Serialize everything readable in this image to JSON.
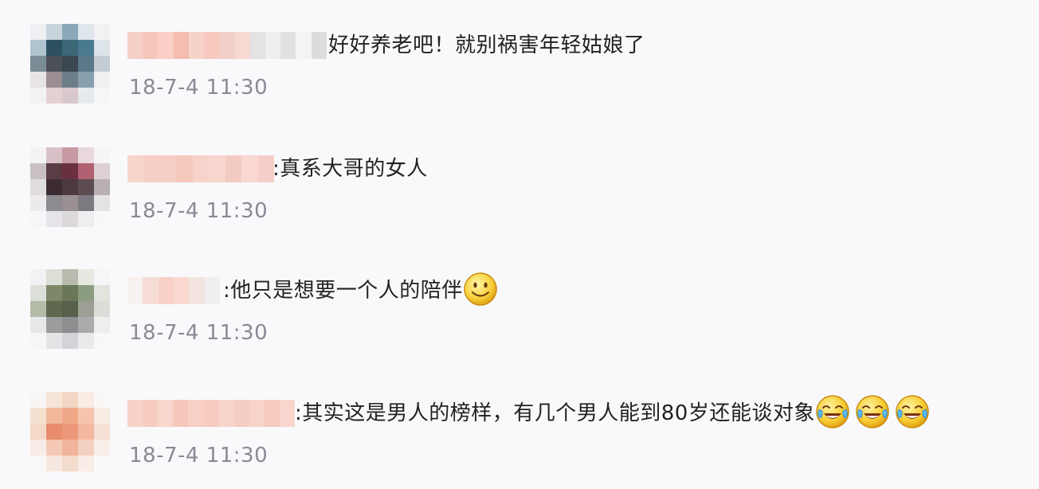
{
  "comments": [
    {
      "text": "好好养老吧！就别祸害年轻姑娘了",
      "time": "18-7-4 11:30",
      "emojis": [],
      "avatar_colors": [
        "#f0f0f4",
        "#c8d4dc",
        "#8ca8b8",
        "#dfe6ec",
        "#f2f2f4",
        "#b0c4d0",
        "#2c5060",
        "#3c6878",
        "#4a7a90",
        "#dde4ea",
        "#7a8c96",
        "#4c5058",
        "#3a4650",
        "#5a7888",
        "#c4ccd4",
        "#e8e4e6",
        "#9c8e92",
        "#6c7e88",
        "#88a0ae",
        "#eef0f2",
        "#f4f2f4",
        "#e4d0d2",
        "#d8c8cc",
        "#e6eaee",
        "#f6f6f8"
      ],
      "name_colors": [
        "#f5d0c8",
        "#f7c6bb",
        "#f9cfc6",
        "#f4bdb0",
        "#f6d2c9",
        "#f7c9bf",
        "#f2cfc9",
        "#f7d8d2",
        "#e4e2e4",
        "#eeeeee",
        "#e2e2e4",
        "#f4f4f6",
        "#dcdcde"
      ]
    },
    {
      "text": ":真系大哥的女人",
      "time": "18-7-4 11:30",
      "emojis": [],
      "avatar_colors": [
        "#f4f2f4",
        "#d8c0c6",
        "#c89aa4",
        "#e8d8dc",
        "#f6f4f6",
        "#c8c0c4",
        "#5a3c44",
        "#6a3040",
        "#b06070",
        "#dcd0d4",
        "#e0dcde",
        "#3c2c32",
        "#4c3a40",
        "#5c4c52",
        "#b8b0b4",
        "#eceaec",
        "#8c8c90",
        "#9a9094",
        "#7c7a80",
        "#e4e2e4",
        "#f6f6f8",
        "#e6e4e8",
        "#dcd8dc",
        "#eeeef0",
        "#f8f8fa"
      ],
      "name_colors": [
        "#f7d5cc",
        "#f8cfc4",
        "#f6cec6",
        "#f5c9bd",
        "#f7d3cb",
        "#f8d6ce",
        "#f4cbc2",
        "#f8d8d1",
        "#f4cec7"
      ]
    },
    {
      "text": ":他只是想要一个人的陪伴",
      "time": "18-7-4 11:30",
      "emojis": [
        "smile"
      ],
      "avatar_colors": [
        "#f2f2f4",
        "#dcdfd6",
        "#b8bcae",
        "#e6e8e2",
        "#f6f6f8",
        "#dde0d8",
        "#7c8868",
        "#6a7858",
        "#8c9c80",
        "#e2e4de",
        "#b4bca8",
        "#60684e",
        "#58604c",
        "#9ca094",
        "#dcdcd8",
        "#e8e8ea",
        "#9a9c9e",
        "#8c8e90",
        "#a8aaac",
        "#eeeeef",
        "#f6f6f8",
        "#e4e4e6",
        "#d4d4d8",
        "#eaeaec",
        "#f8f8fa"
      ],
      "name_colors": [
        "#f7f1ef",
        "#f6dcd6",
        "#f8d0c6",
        "#f9d8d0",
        "#f4e4e0",
        "#efefef"
      ]
    },
    {
      "text": ":其实这是男人的榜样，有几个男人能到80岁还能谈对象",
      "time": "18-7-4 11:30",
      "emojis": [
        "laugh-cry",
        "laugh-cry",
        "laugh-cry"
      ],
      "avatar_colors": [
        "#f8f6f4",
        "#f6e4d8",
        "#f4d6c4",
        "#f8ece4",
        "#faf8f6",
        "#f6e0d0",
        "#f2b89c",
        "#f0a888",
        "#f4c4ac",
        "#f8ece4",
        "#f4d8c8",
        "#e88c6c",
        "#ec9878",
        "#f2b8a0",
        "#f6e0d4",
        "#f8ece6",
        "#f4c8b4",
        "#f0b49c",
        "#f4d0c0",
        "#f8eee8",
        "#faf8f6",
        "#f6e8e0",
        "#f4dccc",
        "#f8ece6",
        "#fafaf8"
      ],
      "name_colors": [
        "#f8d2c8",
        "#f7cdc2",
        "#f9d6cc",
        "#f5c7bb",
        "#f8d0c6",
        "#f7cbbf",
        "#f8d4ca",
        "#f6cdc3",
        "#f8d3c9",
        "#f5cbc0",
        "#f8d6cd"
      ]
    }
  ],
  "emoji_icons": {
    "smile": "smile-face-icon",
    "laugh-cry": "laugh-cry-face-icon"
  }
}
